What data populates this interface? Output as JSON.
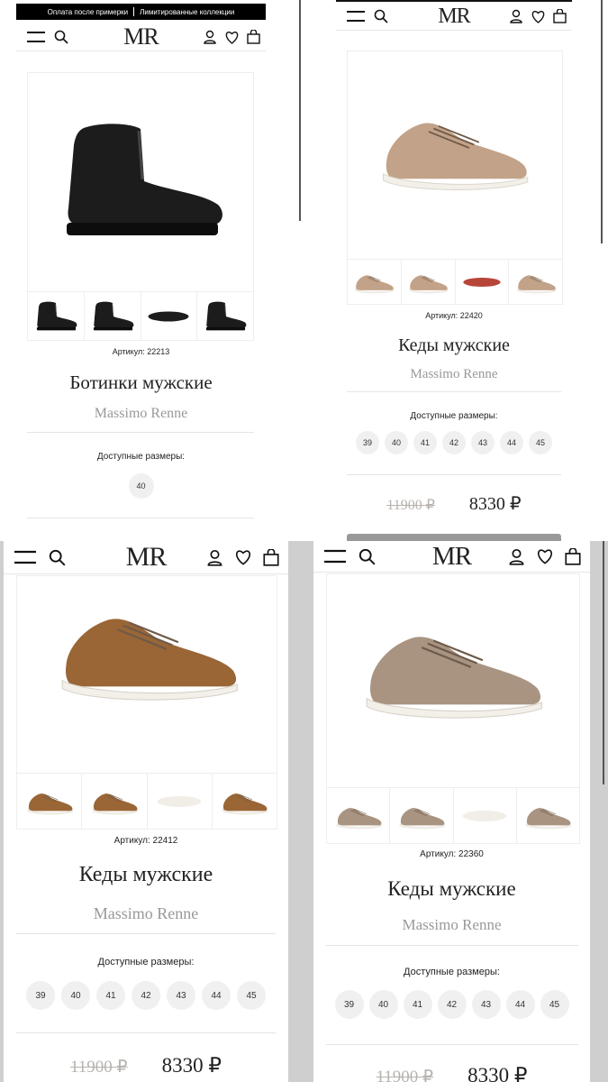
{
  "panels": [
    {
      "promo": {
        "left": "Оплата после примерки",
        "right": "Лимитированные коллекции"
      },
      "logo": "MR",
      "article": "Артикул: 22213",
      "title": "Ботинки мужские",
      "brand": "Massimo Renne",
      "sizes_label": "Доступные размеры:",
      "sizes": [
        "40"
      ],
      "product_color": "#1c1c1c"
    },
    {
      "logo": "MR",
      "article": "Артикул: 22420",
      "title": "Кеды мужские",
      "brand": "Massimo Renne",
      "sizes_label": "Доступные размеры:",
      "sizes": [
        "39",
        "40",
        "41",
        "42",
        "43",
        "44",
        "45"
      ],
      "old_price": "11900 ₽",
      "new_price": "8330 ₽",
      "product_color": "#c2a288"
    },
    {
      "logo": "MR",
      "article": "Артикул: 22412",
      "title": "Кеды мужские",
      "brand": "Massimo Renne",
      "sizes_label": "Доступные размеры:",
      "sizes": [
        "39",
        "40",
        "41",
        "42",
        "43",
        "44",
        "45"
      ],
      "old_price": "11900 ₽",
      "new_price": "8330 ₽",
      "product_color": "#9a6636"
    },
    {
      "logo": "MR",
      "article": "Артикул: 22360",
      "title": "Кеды мужские",
      "brand": "Massimo Renne",
      "sizes_label": "Доступные размеры:",
      "sizes": [
        "39",
        "40",
        "41",
        "42",
        "43",
        "44",
        "45"
      ],
      "old_price": "11900 ₽",
      "new_price": "8330 ₽",
      "product_color": "#a89480"
    }
  ]
}
